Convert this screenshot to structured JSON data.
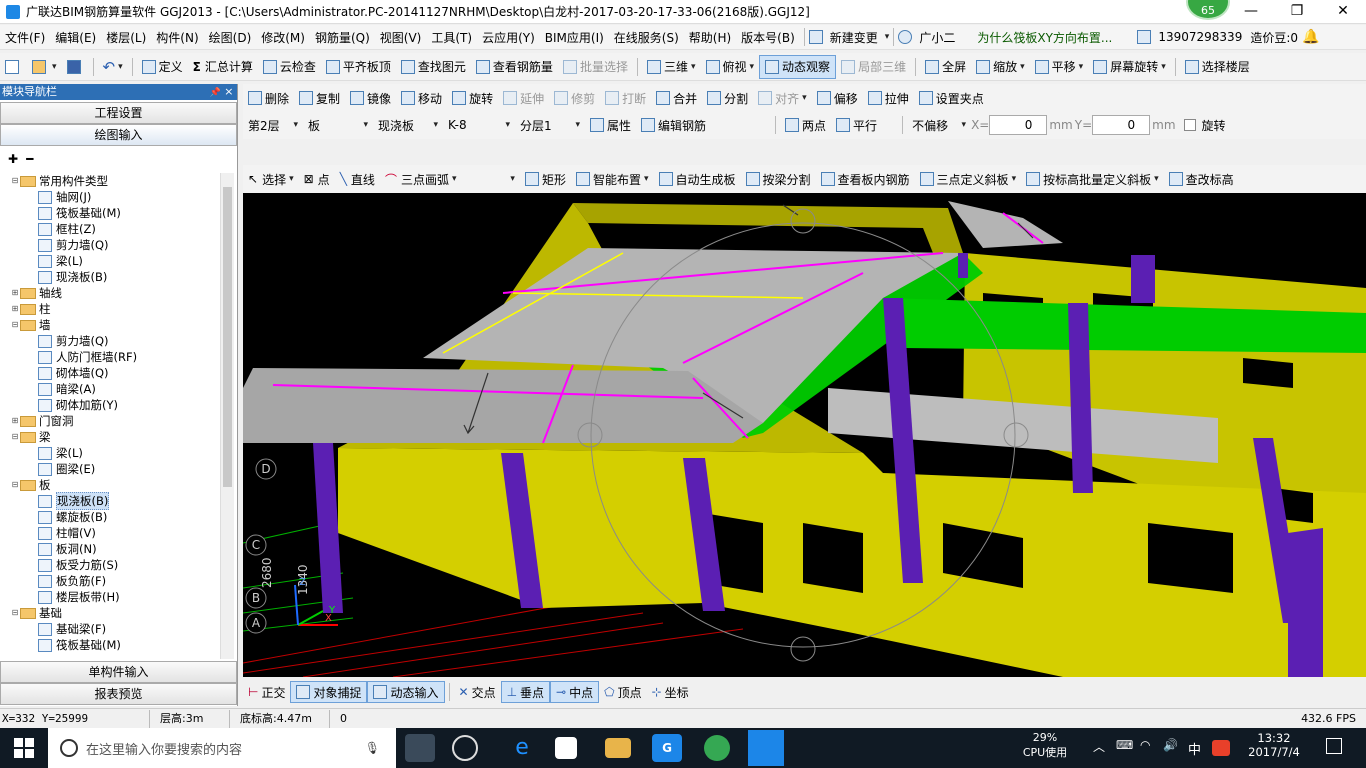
{
  "title_bar": {
    "text": "广联达BIM钢筋算量软件 GGJ2013 - [C:\\Users\\Administrator.PC-20141127NRHM\\Desktop\\白龙村-2017-03-20-17-33-06(2168版).GGJ12]",
    "badge": "65",
    "minimize": "—",
    "maximize": "❐",
    "close": "✕"
  },
  "menu": {
    "items": [
      "文件(F)",
      "编辑(E)",
      "楼层(L)",
      "构件(N)",
      "绘图(D)",
      "修改(M)",
      "钢筋量(Q)",
      "视图(V)",
      "工具(T)",
      "云应用(Y)",
      "BIM应用(I)",
      "在线服务(S)",
      "帮助(H)",
      "版本号(B)"
    ],
    "new_change": "新建变更",
    "guang": "广小二",
    "question": "为什么筏板XY方向布置...",
    "phone": "13907298339",
    "price": "造价豆:0"
  },
  "toolbar1": {
    "define": "定义",
    "summary": "汇总计算",
    "cloud_check": "云检查",
    "align_top": "平齐板顶",
    "find_element": "查找图元",
    "view_rebar": "查看钢筋量",
    "batch_select": "批量选择",
    "view3d": "三维",
    "top_view": "俯视",
    "dynamic_view": "动态观察",
    "local3d": "局部三维",
    "fullscreen": "全屏",
    "zoom": "缩放",
    "pan": "平移",
    "rotate_screen": "屏幕旋转",
    "select_floor": "选择楼层"
  },
  "toolbar2": {
    "delete": "删除",
    "copy": "复制",
    "mirror": "镜像",
    "move": "移动",
    "rotate": "旋转",
    "extend": "延伸",
    "trim": "修剪",
    "break": "打断",
    "merge": "合并",
    "split": "分割",
    "align": "对齐",
    "offset": "偏移",
    "stretch": "拉伸",
    "set_point": "设置夹点"
  },
  "toolbar3": {
    "floor": "第2层",
    "category": "板",
    "type": "现浇板",
    "element": "K-8",
    "layer": "分层1",
    "property": "属性",
    "edit_rebar": "编辑钢筋",
    "two_points": "两点",
    "parallel": "平行",
    "offset_mode": "不偏移",
    "x_label": "X=",
    "x_value": "0",
    "y_label": "Y=",
    "y_value": "0",
    "unit": "mm",
    "rotate": "旋转"
  },
  "toolbar4": {
    "select": "选择",
    "point": "点",
    "line": "直线",
    "arc": "三点画弧",
    "rect": "矩形",
    "smart_layout": "智能布置",
    "auto_slab": "自动生成板",
    "beam_split": "按梁分割",
    "view_slab_rebar": "查看板内钢筋",
    "three_point_slope": "三点定义斜板",
    "batch_slope": "按标高批量定义斜板",
    "edit_elevation": "查改标高"
  },
  "left_panel": {
    "title": "模块导航栏",
    "pin": "📌",
    "close": "×",
    "project_settings": "工程设置",
    "drawing_input": "绘图输入",
    "single_input": "单构件输入",
    "report_preview": "报表预览",
    "tree": [
      {
        "level": 0,
        "toggle": "⊟",
        "type": "folder",
        "label": "常用构件类型"
      },
      {
        "level": 1,
        "type": "item",
        "label": "轴网(J)"
      },
      {
        "level": 1,
        "type": "item",
        "label": "筏板基础(M)"
      },
      {
        "level": 1,
        "type": "item",
        "label": "框柱(Z)"
      },
      {
        "level": 1,
        "type": "item",
        "label": "剪力墙(Q)"
      },
      {
        "level": 1,
        "type": "item",
        "label": "梁(L)"
      },
      {
        "level": 1,
        "type": "item",
        "label": "现浇板(B)"
      },
      {
        "level": 0,
        "toggle": "⊞",
        "type": "folder",
        "label": "轴线"
      },
      {
        "level": 0,
        "toggle": "⊞",
        "type": "folder",
        "label": "柱"
      },
      {
        "level": 0,
        "toggle": "⊟",
        "type": "folder",
        "label": "墙"
      },
      {
        "level": 1,
        "type": "item",
        "label": "剪力墙(Q)"
      },
      {
        "level": 1,
        "type": "item",
        "label": "人防门框墙(RF)"
      },
      {
        "level": 1,
        "type": "item",
        "label": "砌体墙(Q)"
      },
      {
        "level": 1,
        "type": "item",
        "label": "暗梁(A)"
      },
      {
        "level": 1,
        "type": "item",
        "label": "砌体加筋(Y)"
      },
      {
        "level": 0,
        "toggle": "⊞",
        "type": "folder",
        "label": "门窗洞"
      },
      {
        "level": 0,
        "toggle": "⊟",
        "type": "folder",
        "label": "梁"
      },
      {
        "level": 1,
        "type": "item",
        "label": "梁(L)"
      },
      {
        "level": 1,
        "type": "item",
        "label": "圈梁(E)"
      },
      {
        "level": 0,
        "toggle": "⊟",
        "type": "folder",
        "label": "板"
      },
      {
        "level": 1,
        "type": "item",
        "label": "现浇板(B)",
        "selected": true
      },
      {
        "level": 1,
        "type": "item",
        "label": "螺旋板(B)"
      },
      {
        "level": 1,
        "type": "item",
        "label": "柱帽(V)"
      },
      {
        "level": 1,
        "type": "item",
        "label": "板洞(N)"
      },
      {
        "level": 1,
        "type": "item",
        "label": "板受力筋(S)"
      },
      {
        "level": 1,
        "type": "item",
        "label": "板负筋(F)"
      },
      {
        "level": 1,
        "type": "item",
        "label": "楼层板带(H)"
      },
      {
        "level": 0,
        "toggle": "⊟",
        "type": "folder",
        "label": "基础"
      },
      {
        "level": 1,
        "type": "item",
        "label": "基础梁(F)"
      },
      {
        "level": 1,
        "type": "item",
        "label": "筏板基础(M)"
      }
    ]
  },
  "viewport": {
    "axis_labels": [
      "D",
      "C",
      "B",
      "A"
    ],
    "dim1": "2680",
    "dim2": "1340",
    "axis_x": "X",
    "axis_y": "Y",
    "axis_z": "Z",
    "colors": {
      "beam": "#c8c400",
      "column": "#5b1fb3",
      "slab": "#b4b4b4",
      "green_beam": "#00cc00",
      "magenta": "#ff00ff"
    }
  },
  "snapbar": {
    "ortho": "正交",
    "object_snap": "对象捕捉",
    "dynamic_input": "动态输入",
    "intersection": "交点",
    "perpendicular": "垂点",
    "midpoint": "中点",
    "vertex": "顶点",
    "coordinate": "坐标"
  },
  "status": {
    "coords": "X=332 Y=25999",
    "floor_height": "层高:3m",
    "bottom_elev": "底标高:4.47m",
    "value": "0",
    "fps": "432.6 FPS"
  },
  "taskbar": {
    "search_placeholder": "在这里输入你要搜索的内容",
    "cpu_pct": "29%",
    "cpu_label": "CPU使用",
    "ime": "中",
    "time": "13:32",
    "date": "2017/7/4"
  }
}
